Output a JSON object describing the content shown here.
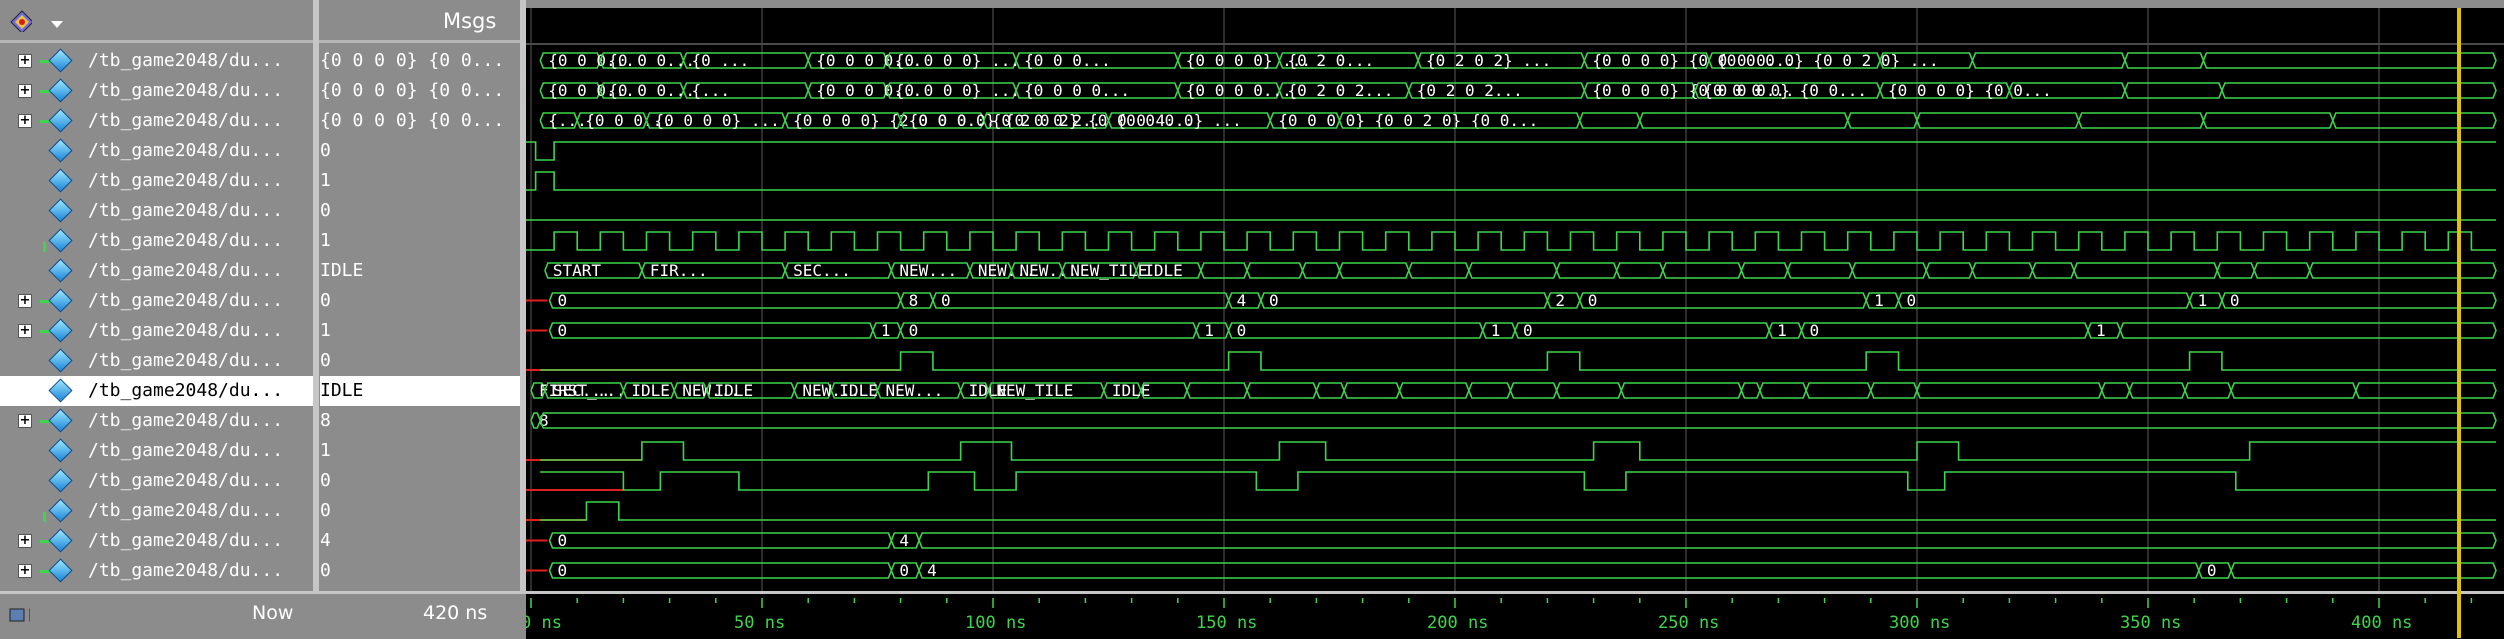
{
  "header": {
    "msgs_label": "Msgs"
  },
  "rows": [
    {
      "name": "/tb_game2048/du...",
      "value": "{0 0 0 0} {0 0...",
      "expandable": true,
      "icon": "bus-icon"
    },
    {
      "name": "/tb_game2048/du...",
      "value": "{0 0 0 0} {0 0...",
      "expandable": true,
      "icon": "bus-icon"
    },
    {
      "name": "/tb_game2048/du...",
      "value": "{0 0 0 0} {0 0...",
      "expandable": true,
      "icon": "bus-icon"
    },
    {
      "name": "/tb_game2048/du...",
      "value": "0",
      "expandable": false,
      "icon": "signal-icon"
    },
    {
      "name": "/tb_game2048/du...",
      "value": "1",
      "expandable": false,
      "icon": "signal-icon"
    },
    {
      "name": "/tb_game2048/du...",
      "value": "0",
      "expandable": false,
      "icon": "signal-icon"
    },
    {
      "name": "/tb_game2048/du...",
      "value": "1",
      "expandable": false,
      "icon": "signal-icon"
    },
    {
      "name": "/tb_game2048/du...",
      "value": "IDLE",
      "expandable": false,
      "icon": "signal-icon"
    },
    {
      "name": "/tb_game2048/du...",
      "value": "0",
      "expandable": true,
      "icon": "bus-icon"
    },
    {
      "name": "/tb_game2048/du...",
      "value": "1",
      "expandable": true,
      "icon": "bus-icon"
    },
    {
      "name": "/tb_game2048/du...",
      "value": "0",
      "expandable": false,
      "icon": "signal-icon"
    },
    {
      "name": "/tb_game2048/du...",
      "value": "IDLE",
      "expandable": false,
      "icon": "signal-icon",
      "selected": true
    },
    {
      "name": "/tb_game2048/du...",
      "value": "8",
      "expandable": true,
      "icon": "bus-icon"
    },
    {
      "name": "/tb_game2048/du...",
      "value": "1",
      "expandable": false,
      "icon": "signal-icon"
    },
    {
      "name": "/tb_game2048/du...",
      "value": "0",
      "expandable": false,
      "icon": "signal-icon"
    },
    {
      "name": "/tb_game2048/du...",
      "value": "0",
      "expandable": false,
      "icon": "signal-icon"
    },
    {
      "name": "/tb_game2048/du...",
      "value": "4",
      "expandable": true,
      "icon": "bus-icon"
    },
    {
      "name": "/tb_game2048/du...",
      "value": "0",
      "expandable": true,
      "icon": "bus-icon"
    }
  ],
  "footer": {
    "now_label": "Now",
    "now_value": "420 ns"
  },
  "timeline": {
    "labels": [
      "0 ns",
      "50 ns",
      "100 ns",
      "150 ns",
      "200 ns",
      "250 ns",
      "300 ns",
      "350 ns",
      "400 ns"
    ],
    "cursor_ns": 420
  },
  "waves": {
    "bus0": [
      "{0 0 0...",
      "{0 0 0...",
      "{0 ...",
      "{0 0 0 0...",
      "{0 0 0 0} ...",
      "{0 0 0...",
      "{0 0 0 0} ...",
      "{0 2 0...",
      "{0 2 0 2} ...",
      "{0 0 0 0} {0 0 0 0...",
      "{0 0 0 0} {0 0 2 0} ..."
    ],
    "bus1": [
      "{0 0 0...",
      "{0 0 0...",
      "{...",
      "{0 0 0 0...",
      "{0 0 0 0} ...",
      "{0 0 0 0...",
      "{0 0 0 0...",
      "{0 2 0 2...",
      "{0 2 0 2...",
      "{0 0 0 0} {0 0 0 0...",
      "{0 0 0 0} {0 0...",
      "{0 0 0 0} {0 0..."
    ],
    "bus2": [
      "{...",
      "{0 0 0...",
      "{0 0 0 0} ...",
      "{0 0 0 0} {2 0 0 0...",
      "{0 0 0 0} {0 0 0 2...",
      "{0 2 0 2} {0 0 0 4...",
      "{0 0 0 0} ...",
      "{0 0 0 0} {0 0 2 0} {0 0..."
    ],
    "state1": [
      "START",
      "FIR...",
      "SEC...",
      "NEW...",
      "NEW...",
      "NEW...",
      "NEW_TILE",
      "IDLE"
    ],
    "bus8": [
      "0",
      "8",
      "0",
      "4",
      "0",
      "2",
      "0",
      "1",
      "0",
      "1",
      "0"
    ],
    "bus9": [
      "0",
      "1",
      "0",
      "1",
      "0",
      "1",
      "0",
      "1",
      "0",
      "1"
    ],
    "state2": [
      "FIRST_...",
      "SEC...",
      "IDLE",
      "NEW...",
      "IDLE",
      "NEW...",
      "IDLE",
      "NEW...",
      "IDLE",
      "NEW_TILE",
      "IDLE"
    ],
    "bus12": [
      "8"
    ],
    "bus16": [
      "0",
      "4"
    ],
    "bus17": [
      "0",
      "0",
      "4",
      "0"
    ]
  }
}
